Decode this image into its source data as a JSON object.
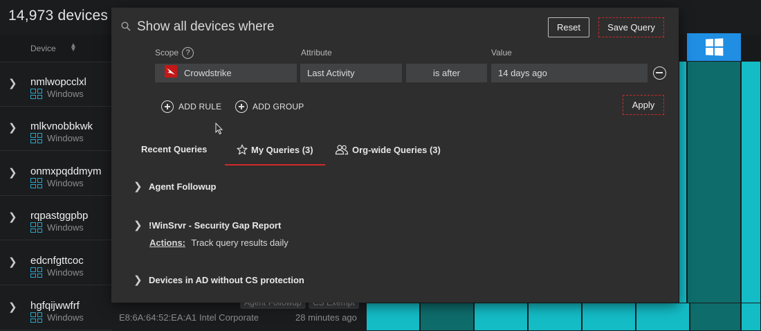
{
  "page": {
    "device_count_title": "14,973 devices",
    "column_device_label": "Device",
    "rows": [
      {
        "name": "nmlwopcclxl",
        "os": "Windows"
      },
      {
        "name": "mlkvnobbkwk",
        "os": "Windows"
      },
      {
        "name": "onmxpqddmym",
        "os": "Windows"
      },
      {
        "name": "rqpastggpbp",
        "os": "Windows"
      },
      {
        "name": "edcnfgttcoc",
        "os": "Windows"
      },
      {
        "name": "hgfqijwwfrf",
        "os": "Windows",
        "mac": "E8:6A:64:52:EA:A1",
        "vendor": "Intel Corporate",
        "last_seen": "28 minutes ago",
        "tags": [
          "Agent Followup",
          "CS Exempt"
        ]
      }
    ],
    "colors": {
      "teal": "#14bcc6",
      "dark_teal": "#0e6c6b",
      "windows_blue": "#1f8ee3",
      "accent_red": "#d12a2a"
    }
  },
  "modal": {
    "search_title": "Show all devices where",
    "reset_label": "Reset",
    "save_query_label": "Save Query",
    "labels": {
      "scope": "Scope",
      "attribute": "Attribute",
      "value": "Value"
    },
    "rule": {
      "scope": "Crowdstrike",
      "attribute": "Last Activity",
      "operator": "is after",
      "value": "14 days ago"
    },
    "add_rule_label": "ADD RULE",
    "add_group_label": "ADD GROUP",
    "apply_label": "Apply",
    "tabs": [
      {
        "label": "Recent Queries",
        "active": false
      },
      {
        "label": "My Queries (3)",
        "active": true,
        "icon": "star-icon"
      },
      {
        "label": "Org-wide Queries (3)",
        "active": false,
        "icon": "users-icon"
      }
    ],
    "queries": [
      {
        "name": "Agent Followup"
      },
      {
        "name": "!WinSrvr - Security Gap Report",
        "actions_label": "Actions:",
        "actions_text": "Track query results daily"
      },
      {
        "name": "Devices in AD without CS protection"
      }
    ]
  }
}
